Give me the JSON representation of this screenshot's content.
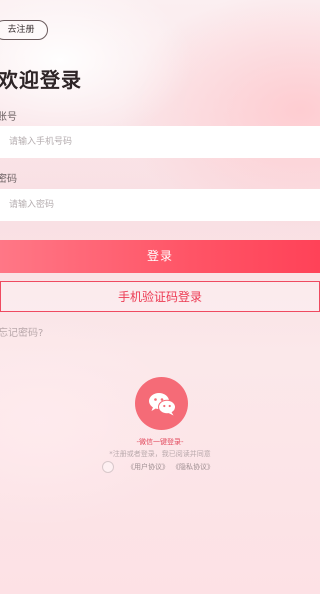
{
  "header": {
    "register_label": "去注册"
  },
  "page": {
    "title": "欢迎登录"
  },
  "form": {
    "account_label": "账号",
    "account_placeholder": "请输入手机号码",
    "password_label": "密码",
    "password_placeholder": "请输入密码"
  },
  "actions": {
    "login_label": "登录",
    "sms_login_label": "手机验证码登录",
    "forgot_label": "忘记密码?"
  },
  "wechat": {
    "label": "-微信一键登录-",
    "icon": "wechat-icon"
  },
  "agreement": {
    "notice": "*注册或者登录，我已阅读并同意",
    "user_agreement": "《用户协议》",
    "privacy_agreement": "《隐私协议》"
  },
  "colors": {
    "accent": "#ff5466",
    "wechat_bg": "#f56b77",
    "link_red": "#ec3a52"
  }
}
